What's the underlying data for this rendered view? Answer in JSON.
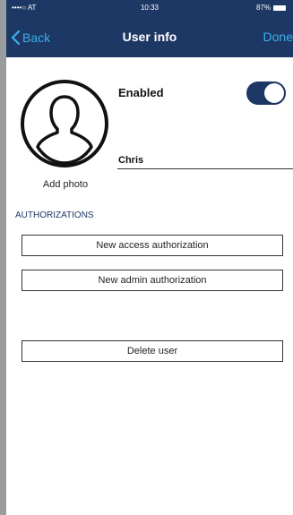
{
  "status_bar": {
    "carrier": "••••○ AT",
    "time": "10:33",
    "battery": "87%"
  },
  "nav": {
    "back_label": "Back",
    "title": "User info",
    "done_label": "Done"
  },
  "profile": {
    "add_photo_label": "Add photo",
    "enabled_label": "Enabled",
    "enabled": true,
    "name_value": "Chris"
  },
  "authorizations": {
    "header": "AUTHORIZATIONS",
    "new_access_label": "New access authorization",
    "new_admin_label": "New admin authorization"
  },
  "actions": {
    "delete_label": "Delete user"
  },
  "colors": {
    "nav_bg": "#1e3865",
    "accent": "#3ab0ea"
  }
}
